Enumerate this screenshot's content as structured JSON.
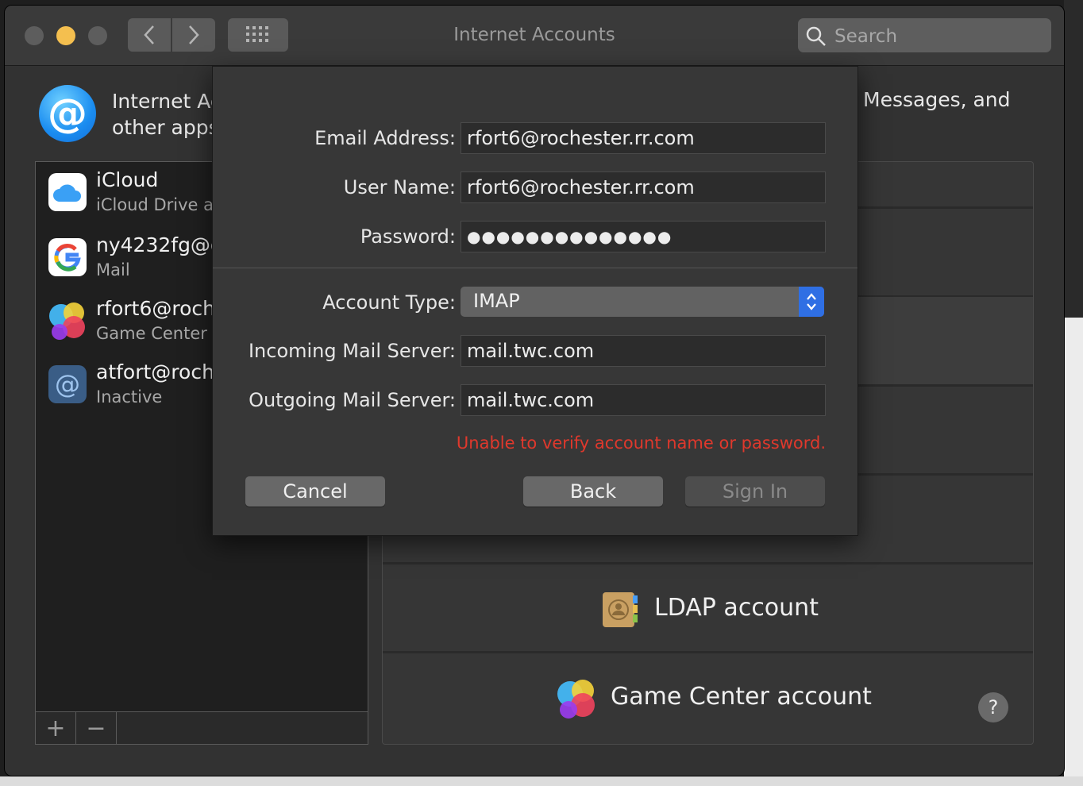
{
  "window": {
    "title": "Internet Accounts",
    "search_placeholder": "Search"
  },
  "header": {
    "line1": "Internet Ac",
    "line2": "other apps",
    "right_text": "Messages, and"
  },
  "accounts": [
    {
      "name": "iCloud",
      "sub": "iCloud Drive a",
      "icon": "icloud-icon"
    },
    {
      "name": "ny4232fg@g",
      "sub": "Mail",
      "icon": "google-icon"
    },
    {
      "name": "rfort6@roch",
      "sub": "Game Center",
      "icon": "game-center-icon"
    },
    {
      "name": "atfort@roch",
      "sub": "Inactive",
      "icon": "at-sign-icon"
    }
  ],
  "list_toolbar": {
    "add": "+",
    "remove": "−"
  },
  "providers": {
    "ldap": "LDAP account",
    "game_center": "Game Center account",
    "help": "?"
  },
  "dialog": {
    "email_label": "Email Address:",
    "email_value": "rfort6@rochester.rr.com",
    "username_label": "User Name:",
    "username_value": "rfort6@rochester.rr.com",
    "password_label": "Password:",
    "password_value": "●●●●●●●●●●●●●●",
    "account_type_label": "Account Type:",
    "account_type_value": "IMAP",
    "incoming_label": "Incoming Mail Server:",
    "incoming_value": "mail.twc.com",
    "outgoing_label": "Outgoing Mail Server:",
    "outgoing_value": "mail.twc.com",
    "error": "Unable to verify account name or password.",
    "cancel": "Cancel",
    "back": "Back",
    "sign_in": "Sign In"
  },
  "colors": {
    "accent": "#2f6fe4",
    "error": "#e0382c",
    "minimize": "#f4bf4f"
  }
}
